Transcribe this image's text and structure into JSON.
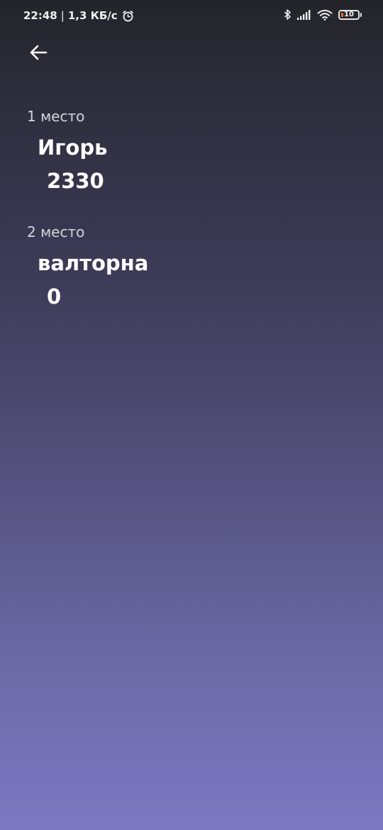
{
  "status_bar": {
    "time": "22:48",
    "separator": "|",
    "network_speed": "1,3 КБ/с",
    "battery_level": "10",
    "icons": [
      "alarm-icon",
      "bluetooth-icon",
      "signal-icon",
      "wifi-icon",
      "battery-icon"
    ]
  },
  "header": {
    "back_icon": "arrow-left-icon"
  },
  "leaderboard": [
    {
      "place": "1 место",
      "name": "Игорь",
      "score": "2330"
    },
    {
      "place": "2 место",
      "name": "валторна",
      "score": "0"
    }
  ],
  "colors": {
    "gradient_top": "#24242a",
    "gradient_bottom": "#7c79c3",
    "battery_low": "#ff6a2b"
  }
}
